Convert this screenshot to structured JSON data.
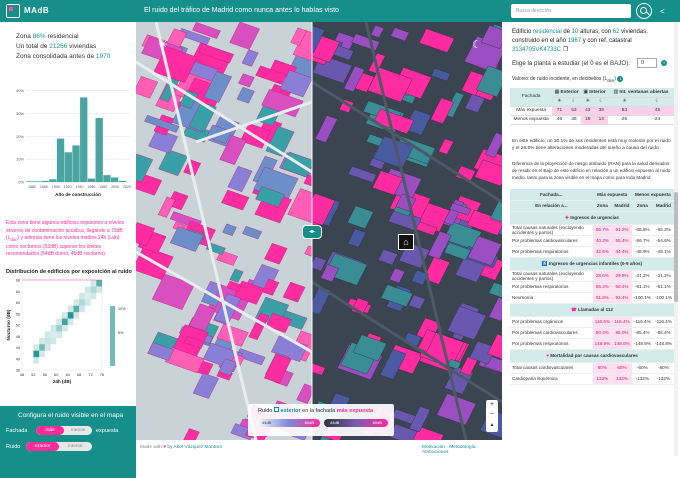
{
  "header": {
    "brand": "MAdB",
    "tagline": "El ruido del tráfico de Madrid como nunca antes lo habías visto",
    "search_placeholder": "Busca dirección"
  },
  "zone": {
    "pct": "86%",
    "line1_a": "Zona ",
    "line1_b": " residencial",
    "line2_a": "Un total de ",
    "count": "21266",
    "line2_b": " viviendas",
    "line3_a": "Zona consolidada antes de ",
    "year": "1970"
  },
  "histogram": {
    "type": "bar",
    "categories": [
      "1860",
      "1880",
      "1900",
      "1920",
      "1940",
      "1960",
      "1980",
      "2000",
      "2020"
    ],
    "xlabel": "Año de construcción",
    "yticks": [
      "0%",
      "10%",
      "20%",
      "30%",
      "40%"
    ],
    "values": [
      0.3,
      0.3,
      0.5,
      1.2,
      19,
      13,
      16,
      37,
      1.5,
      28,
      3,
      2,
      0.5
    ],
    "bins_start": 1850,
    "bin_width": 13,
    "ylim": [
      0,
      42
    ]
  },
  "note": {
    "a": "Esta zona tiene algunos edificios expuestos a niveles severos de contaminación acústica, llegando a 73dB (L",
    "sub": "den",
    "b": ") y además tiene los niveles medios 24h (Ldn) como nocturnos (53dB) superan los límites recomendados (54dB durno, 45dB nocturno)."
  },
  "heatmap": {
    "title": "Distribución de edificios por exposición al ruido",
    "xlabel": "24h (dB)",
    "ylabel": "Nocturno (dB)",
    "xticks": [
      "48",
      "52",
      "56",
      "60",
      "64",
      "68",
      "72",
      "76"
    ],
    "yticks": [
      "68",
      "64",
      "60",
      "56",
      "52",
      "48",
      "44",
      "40",
      "36"
    ],
    "legend": [
      "10%",
      "5%"
    ]
  },
  "config": {
    "title": "Configura el ruido visible en el mapa",
    "row1_label": "Fachada",
    "row1_opt1": "más",
    "row1_opt2": "menos",
    "row1_suffix": "expuesta",
    "row2_label": "Ruido",
    "row2_opt1": "exterior",
    "row2_opt2": "interior"
  },
  "map": {
    "legend_prefix": "Ruido",
    "legend_ext": "exterior",
    "legend_mid": " en la fachada ",
    "legend_exp": "más expuesta",
    "day_from": "44dB",
    "day_to": "80dB",
    "night_from": "44dB",
    "night_to": "80dB",
    "zoom_in": "+",
    "zoom_out": "−"
  },
  "footer": {
    "left": "Made with",
    "by": "by Abel Vázquez Montoro",
    "links": "Motivación · Metodología · Atribuciones"
  },
  "building": {
    "a": "Edificio ",
    "type": "residencial",
    "b": " de ",
    "floors": "10",
    "c": " alturas, con ",
    "dw": "62",
    "d": " viviendas, construido en el año ",
    "year": "1967",
    "e": " y con ref. catastral ",
    "ref": "3134705VK4733C"
  },
  "planta": {
    "label": "Elige la planta a estudiar (el 0 es el BAJO):",
    "value": "0"
  },
  "noise": {
    "caption": "Valores de ruido incidente, en decibelios (L",
    "sub": "den",
    "end": ")",
    "h_ext": "Exterior",
    "h_int": "Interior",
    "h_int2": "Int. ventanas abiertas",
    "col": "Fachada",
    "rows": [
      {
        "label": "Más expuesta",
        "v": [
          "71",
          "53",
          "43",
          "39",
          "53",
          "45"
        ]
      },
      {
        "label": "Menos expuesta",
        "v": [
          "46",
          "39",
          "18",
          "14",
          "26",
          "24"
        ]
      }
    ],
    "note": "En este edificio, un 30.1% de sus residentes está muy molesto por el ruido y el 26.5% tiene alteraciones moderadas del sueño a causa del ruido"
  },
  "risk": {
    "intro": "Diferencia de la proyección de riesgo atribuido (RAN) para la salud derivados de residir en el Bajo de este edificio en relación a un edificio expuesto al ruido medio, tanto para la zona visible en el mapa como para toda Madrid",
    "h1": "Fachada...",
    "h2": "Más expuesta",
    "h3": "Menos expuesta",
    "h4": "En relación a...",
    "hz": "Zona",
    "hm": "Madrid",
    "sections": [
      {
        "title": "Ingresos de urgencias",
        "rows": [
          {
            "label": "Total causas naturales (excluyendo accidentes y partos)",
            "v": [
              "56.7%",
              "61.2%",
              "-66.8%",
              "-66.3%"
            ]
          },
          {
            "label": "Por problemas cardiovasculares",
            "v": [
              "40.3%",
              "55.4%",
              "-56.7%",
              "-54.6%"
            ]
          },
          {
            "label": "Por problemas respiratorios",
            "v": [
              "42.6%",
              "44.4%",
              "-46.9%",
              "-48.1%"
            ]
          }
        ]
      },
      {
        "title": "Ingresos de urgencias infantiles (0-9 años)",
        "rows": [
          {
            "label": "Total causas naturales (excluyendo accidentes y partos)",
            "v": [
              "28.6%",
              "29.9%",
              "-31.2%",
              "-31.2%"
            ]
          },
          {
            "label": "Por problemas respiratorios",
            "v": [
              "56.4%",
              "58.4%",
              "-61.1%",
              "-61.1%"
            ]
          },
          {
            "label": "Neumonía",
            "v": [
              "91.8%",
              "93.4%",
              "-100.1%",
              "-100.1%"
            ]
          }
        ]
      },
      {
        "title": "Llamadas al 112",
        "rows": [
          {
            "label": "Por problemas orgánicos",
            "v": [
              "116.6%",
              "116.4%",
              "-116.4%",
              "-116.4%"
            ]
          },
          {
            "label": "Por problemas cardiovasculares",
            "v": [
              "80.4%",
              "85.0%",
              "-85.4%",
              "-86.4%"
            ]
          },
          {
            "label": "Por problemas respiratorios",
            "v": [
              "148.8%",
              "148.8%",
              "-148.8%",
              "-148.8%"
            ]
          }
        ]
      },
      {
        "title": "Mortalidad por causas cardiovasculares",
        "rows": [
          {
            "label": "Total causas cardiovasculares",
            "v": [
              "60%",
              "60%",
              "-60%",
              "-60%"
            ]
          },
          {
            "label": "Cardiopatía isquémica",
            "v": [
              "132%",
              "132%",
              "-132%",
              "-132%"
            ]
          }
        ]
      }
    ]
  },
  "colors": {
    "teal": "#168f8b",
    "pink": "#ff2b9b"
  }
}
